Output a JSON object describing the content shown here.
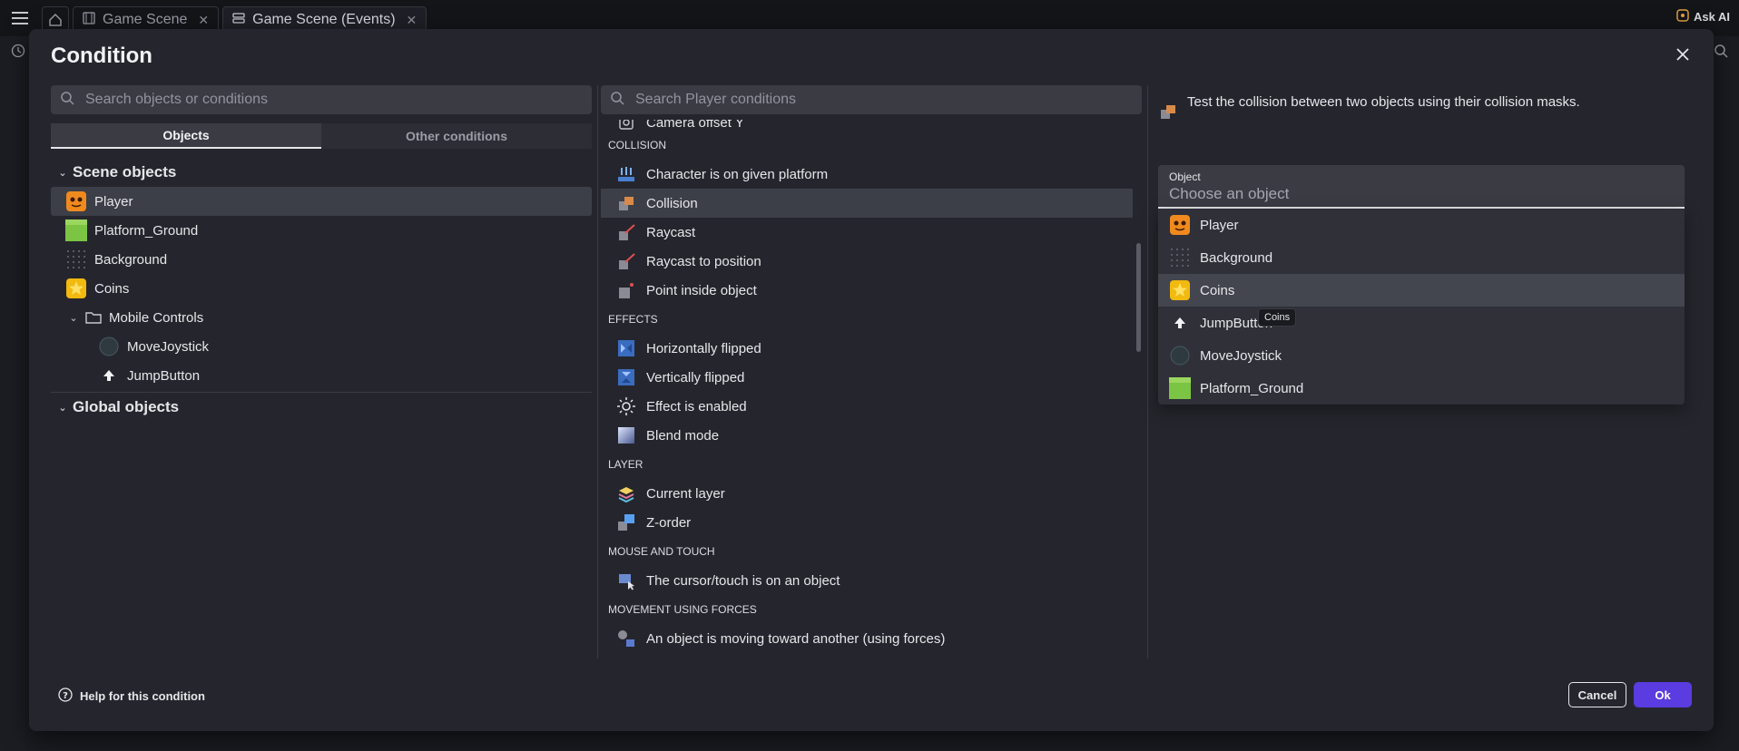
{
  "editor": {
    "tabs": [
      {
        "label": "Game Scene"
      },
      {
        "label": "Game Scene (Events)"
      }
    ],
    "ask_ai": "Ask AI"
  },
  "modal": {
    "title": "Condition"
  },
  "left": {
    "search_placeholder": "Search objects or conditions",
    "tabs": [
      "Objects",
      "Other conditions"
    ],
    "scene_objects_label": "Scene objects",
    "objects": [
      "Player",
      "Platform_Ground",
      "Background",
      "Coins"
    ],
    "folder_label": "Mobile Controls",
    "folder_items": [
      "MoveJoystick",
      "JumpButton"
    ],
    "global_objects_label": "Global objects"
  },
  "middle": {
    "search_placeholder": "Search Player conditions",
    "camera_item": "Camera offset Y",
    "sections": [
      {
        "header": "COLLISION",
        "items": [
          "Character is on given platform",
          "Collision",
          "Raycast",
          "Raycast to position",
          "Point inside object"
        ]
      },
      {
        "header": "EFFECTS",
        "items": [
          "Horizontally flipped",
          "Vertically flipped",
          "Effect is enabled",
          "Blend mode"
        ]
      },
      {
        "header": "LAYER",
        "items": [
          "Current layer",
          "Z-order"
        ]
      },
      {
        "header": "MOUSE AND TOUCH",
        "items": [
          "The cursor/touch is on an object"
        ]
      },
      {
        "header": "MOVEMENT USING FORCES",
        "items": [
          "An object is moving toward another (using forces)"
        ]
      }
    ]
  },
  "right": {
    "description": "Test the collision between two objects using their collision masks.",
    "field_label": "Object",
    "field_placeholder": "Choose an object",
    "options": [
      "Player",
      "Background",
      "Coins",
      "JumpButton",
      "MoveJoystick",
      "Platform_Ground"
    ],
    "tooltip": "Coins"
  },
  "footer": {
    "help": "Help for this condition",
    "cancel": "Cancel",
    "ok": "Ok"
  },
  "colors": {
    "accent": "#5a3ce0",
    "background": "#25262d",
    "selected": "#3d3f48"
  }
}
